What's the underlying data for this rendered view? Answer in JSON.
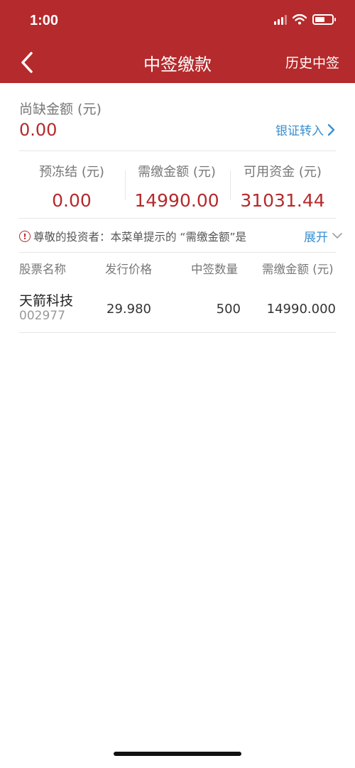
{
  "status_bar": {
    "time": "1:00"
  },
  "nav": {
    "title": "中签缴款",
    "right_action": "历史中签"
  },
  "shortfall": {
    "label": "尚缺金额 (元)",
    "value": "0.00",
    "link_label": "银证转入"
  },
  "stats": [
    {
      "label": "预冻结 (元)",
      "value": "0.00"
    },
    {
      "label": "需缴金额 (元)",
      "value": "14990.00"
    },
    {
      "label": "可用资金 (元)",
      "value": "31031.44"
    }
  ],
  "notice": {
    "text": "尊敬的投资者：本菜单提示的 “需缴金额”是",
    "expand_label": "展开"
  },
  "table": {
    "headers": [
      "股票名称",
      "发行价格",
      "中签数量",
      "需缴金额 (元)"
    ],
    "rows": [
      {
        "name": "天箭科技",
        "code": "002977",
        "price": "29.980",
        "quantity": "500",
        "amount": "14990.000"
      }
    ]
  },
  "colors": {
    "header_bg": "#b52a2c",
    "accent_red": "#b52a2c",
    "link_blue": "#3a8fd0"
  },
  "icons": [
    "back-arrow-icon",
    "chevron-right-icon",
    "info-icon",
    "chevron-down-icon",
    "wifi-icon",
    "battery-icon",
    "signal-icon"
  ]
}
